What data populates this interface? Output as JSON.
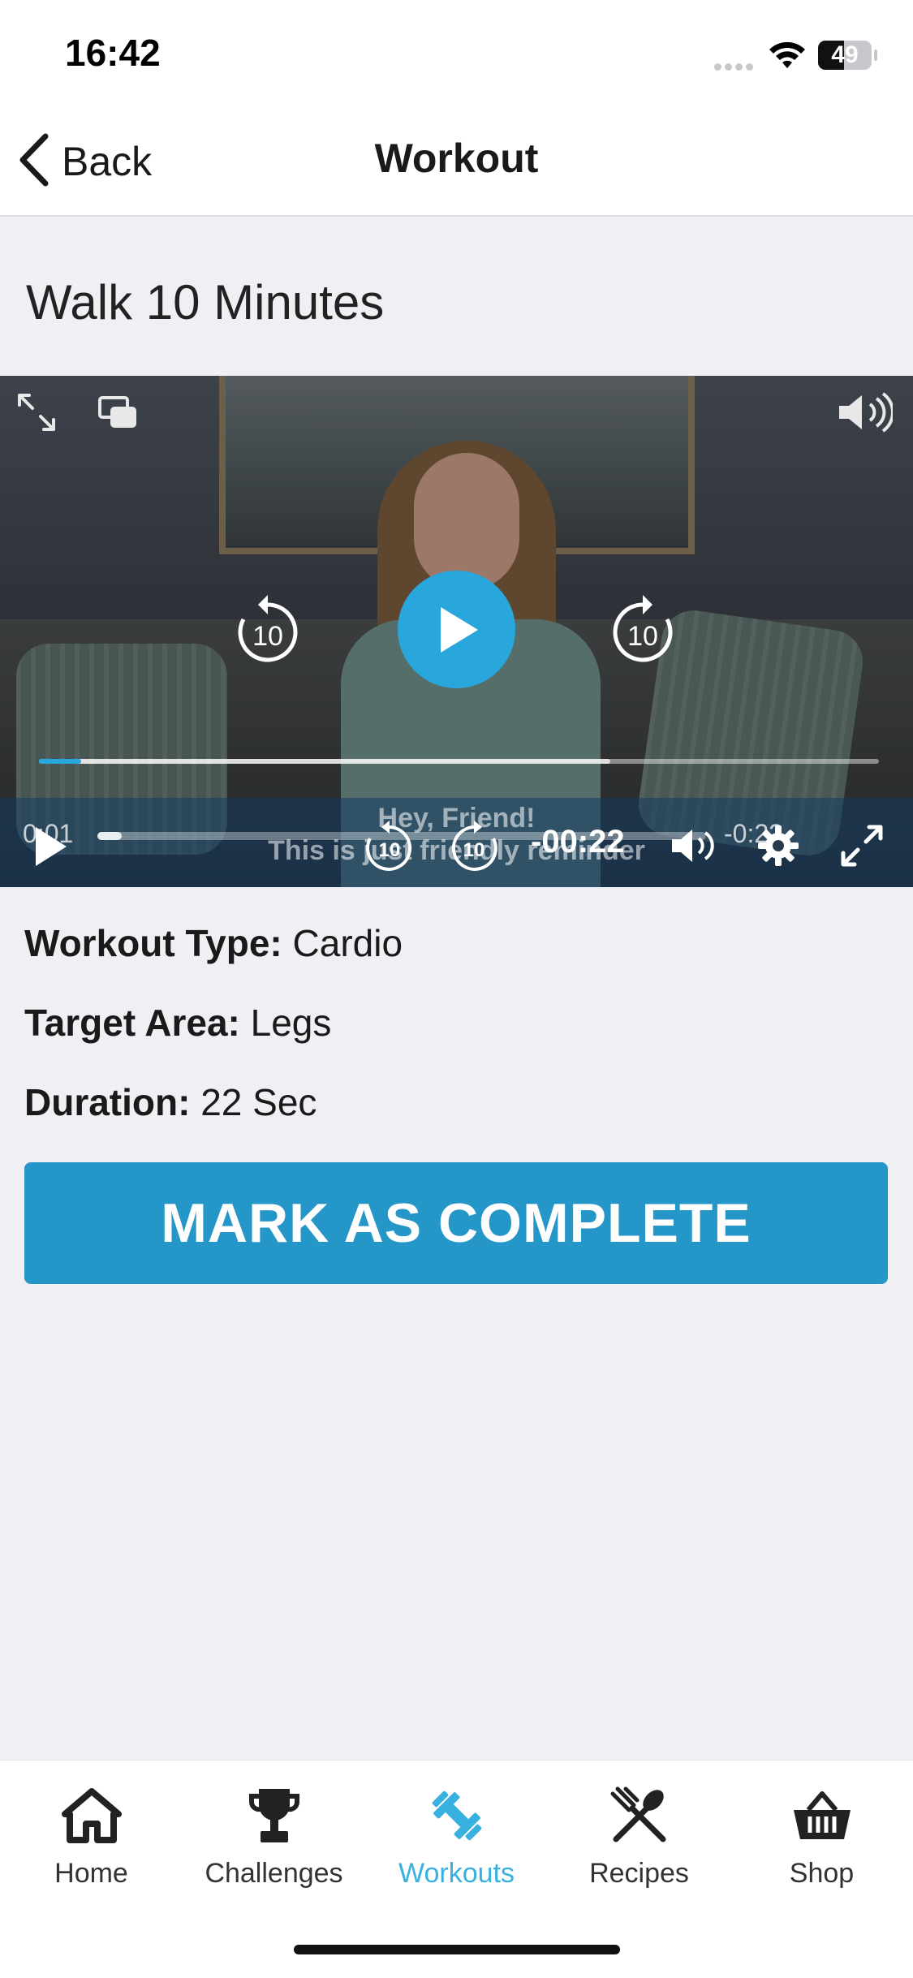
{
  "status_bar": {
    "time": "16:42",
    "battery": "49",
    "battery_level": 0.49
  },
  "nav": {
    "back_label": "Back",
    "title": "Workout"
  },
  "page": {
    "title": "Walk 10 Minutes"
  },
  "video": {
    "rewind_label": "10",
    "forward_label": "10",
    "progress": 0.05,
    "buffered": 0.68,
    "caption_line1": "Hey, Friend!",
    "caption_line2": "This is just friendly reminder",
    "elapsed": "0:01",
    "remaining": "-0:22",
    "bottom_rewind_label": "10",
    "bottom_forward_label": "10",
    "bottom_time": "-00:22",
    "mini_progress": 0.04
  },
  "details": {
    "type_label": "Workout Type:",
    "type_value": " Cardio",
    "area_label": "Target Area:",
    "area_value": " Legs",
    "duration_label": "Duration:",
    "duration_value": " 22 Sec"
  },
  "complete_button": "MARK AS COMPLETE",
  "tabs": [
    {
      "label": "Home",
      "icon": "home-icon"
    },
    {
      "label": "Challenges",
      "icon": "trophy-icon"
    },
    {
      "label": "Workouts",
      "icon": "dumbbell-icon",
      "active": true
    },
    {
      "label": "Recipes",
      "icon": "fork-spoon-icon"
    },
    {
      "label": "Shop",
      "icon": "basket-icon"
    }
  ],
  "colors": {
    "accent": "#2596c8",
    "active_tab": "#38b0e0",
    "play_button": "#29a6dc"
  }
}
